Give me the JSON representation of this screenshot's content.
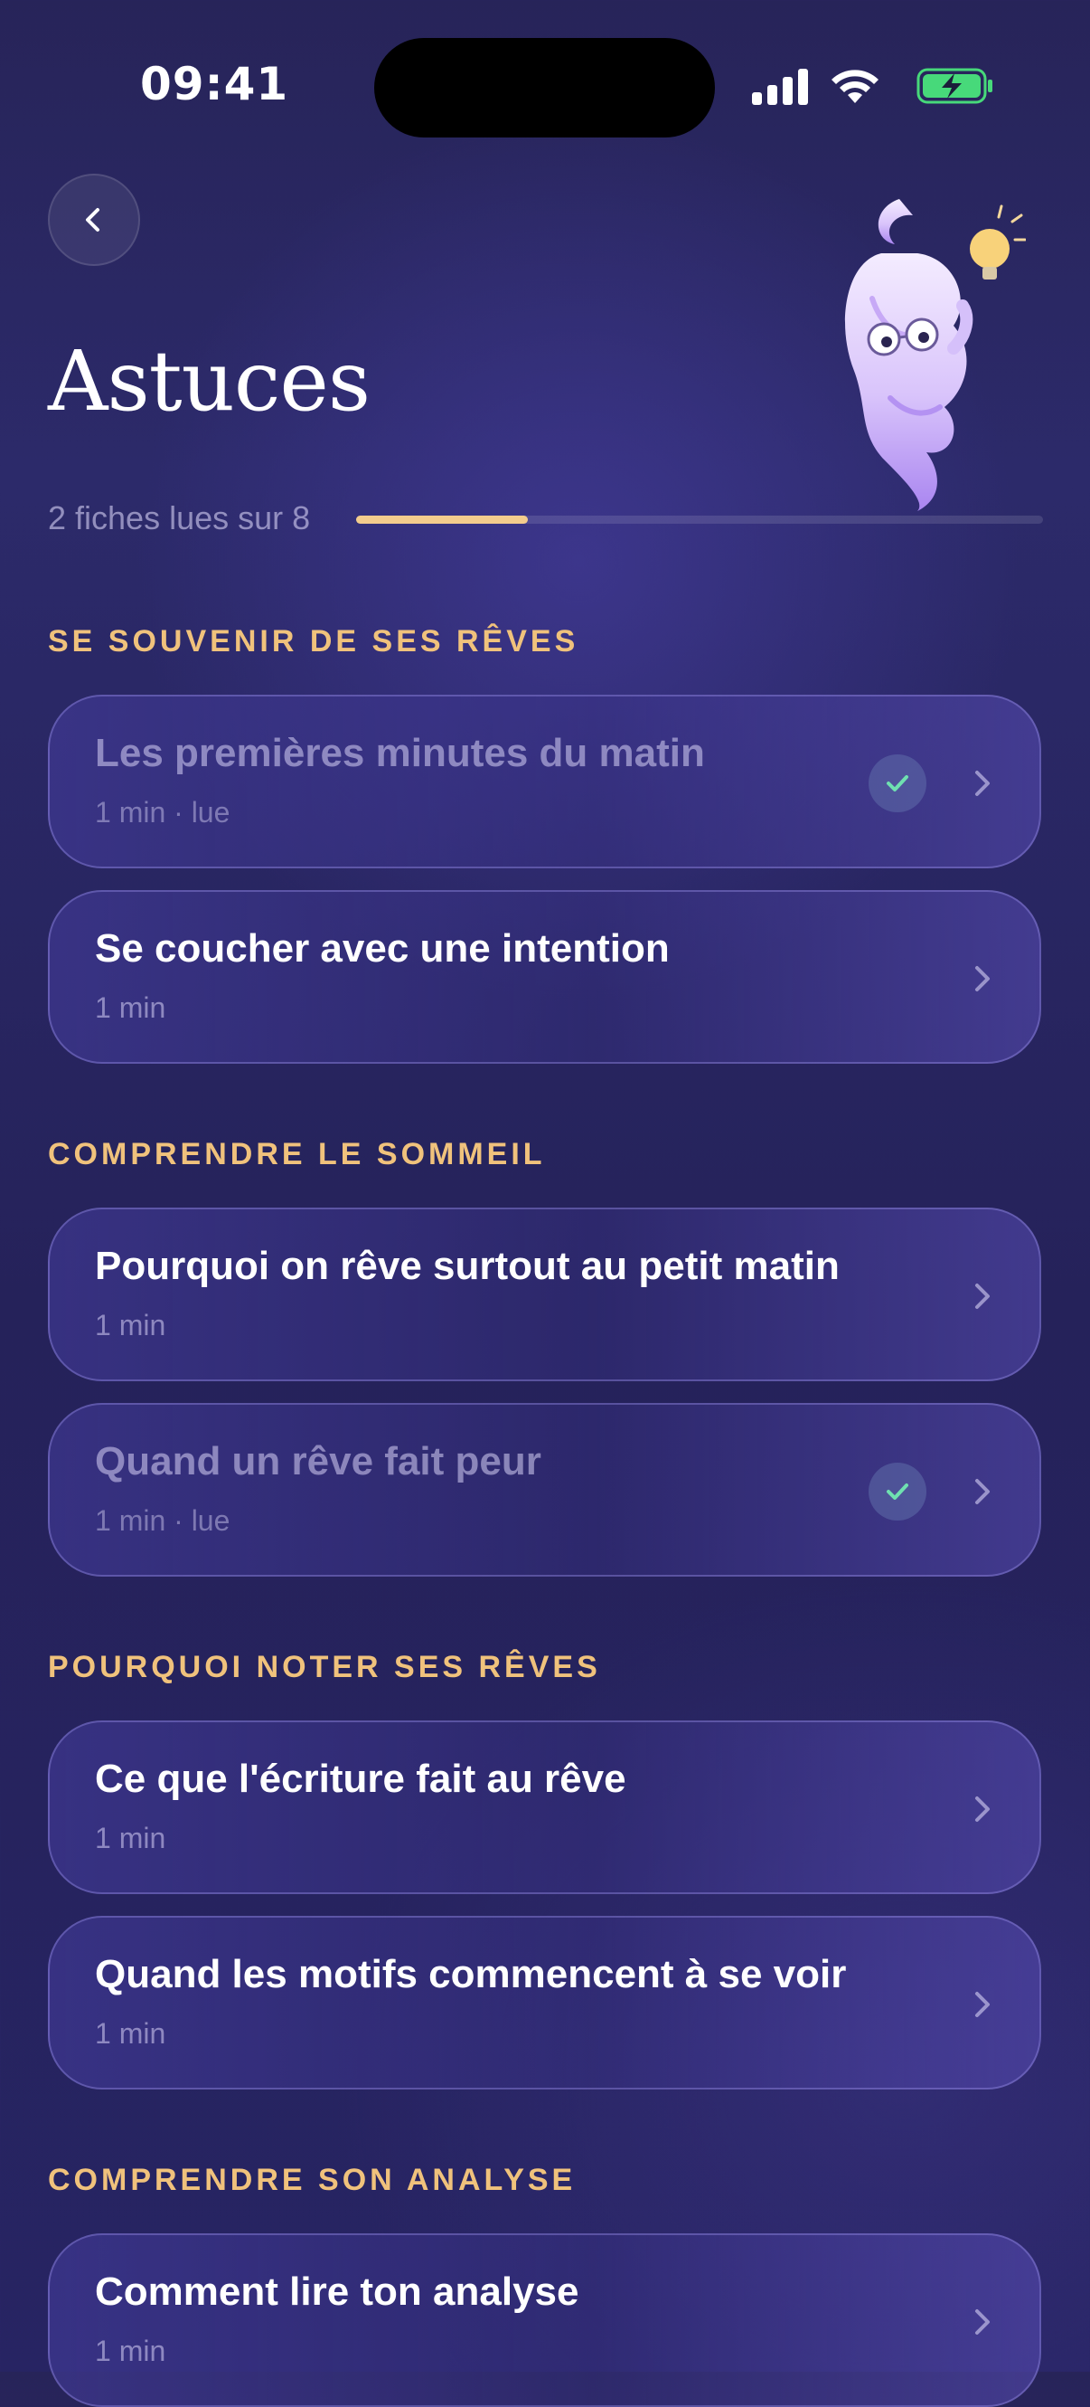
{
  "status_bar": {
    "time": "09:41"
  },
  "header": {
    "title": "Astuces",
    "back_icon": "chevron-left-icon",
    "mascot": "ghost-with-glasses-and-lightbulb"
  },
  "progress": {
    "label": "2 fiches lues sur 8",
    "read": 2,
    "total": 8,
    "fill_color": "#f3cc8d"
  },
  "colors": {
    "section_title": "#f0c27c",
    "check": "#6fe0b0"
  },
  "sections": [
    {
      "title": "SE SOUVENIR DE SES RÊVES",
      "cards": [
        {
          "title": "Les premières minutes du matin",
          "meta": "1 min · lue",
          "read": true
        },
        {
          "title": "Se coucher avec une intention",
          "meta": "1 min",
          "read": false
        }
      ]
    },
    {
      "title": "COMPRENDRE LE SOMMEIL",
      "cards": [
        {
          "title": "Pourquoi on rêve surtout au petit matin",
          "meta": "1 min",
          "read": false
        },
        {
          "title": "Quand un rêve fait peur",
          "meta": "1 min · lue",
          "read": true
        }
      ]
    },
    {
      "title": "POURQUOI NOTER SES RÊVES",
      "cards": [
        {
          "title": "Ce que l'écriture fait au rêve",
          "meta": "1 min",
          "read": false
        },
        {
          "title": "Quand les motifs commencent à se voir",
          "meta": "1 min",
          "read": false
        }
      ]
    },
    {
      "title": "COMPRENDRE SON ANALYSE",
      "cards": [
        {
          "title": "Comment lire ton analyse",
          "meta": "1 min",
          "read": false
        }
      ]
    }
  ]
}
